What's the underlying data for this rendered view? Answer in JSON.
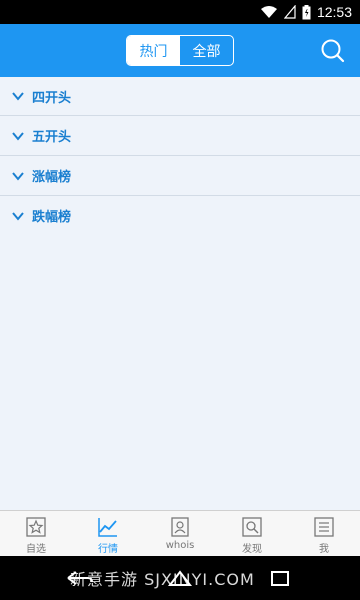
{
  "status_bar": {
    "time": "12:53"
  },
  "header": {
    "tabs": [
      {
        "label": "热门",
        "active": true
      },
      {
        "label": "全部",
        "active": false
      }
    ],
    "search_icon": "search-icon"
  },
  "list": {
    "items": [
      {
        "label": "四开头"
      },
      {
        "label": "五开头"
      },
      {
        "label": "涨幅榜"
      },
      {
        "label": "跌幅榜"
      }
    ]
  },
  "tabbar": {
    "tabs": [
      {
        "label": "自选",
        "icon": "star-icon",
        "active": false
      },
      {
        "label": "行情",
        "icon": "line-chart-icon",
        "active": true
      },
      {
        "label": "whois",
        "icon": "person-card-icon",
        "active": false
      },
      {
        "label": "发现",
        "icon": "discover-search-icon",
        "active": false
      },
      {
        "label": "我",
        "icon": "profile-list-icon",
        "active": false
      }
    ]
  },
  "watermark": "新意手游 SJXINYI.COM",
  "colors": {
    "accent": "#1e96f2",
    "item_text": "#1a7fd0",
    "background": "#eef3fa"
  }
}
